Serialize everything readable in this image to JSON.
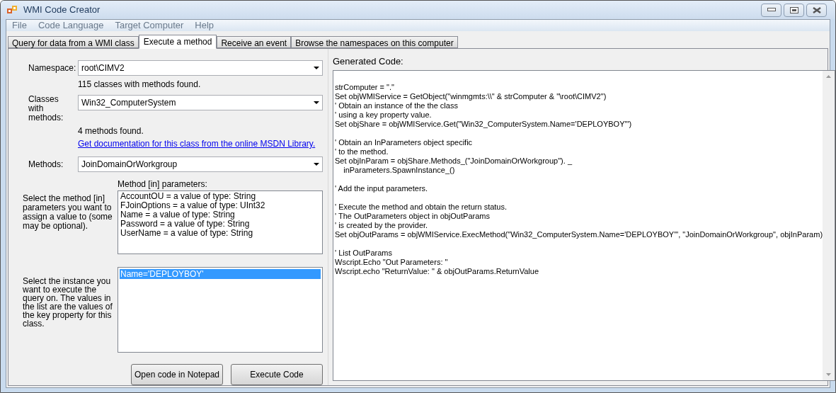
{
  "window": {
    "title": "WMI Code Creator"
  },
  "menu": [
    "File",
    "Code Language",
    "Target Computer",
    "Help"
  ],
  "tabs": [
    {
      "label": "Query for data from a WMI class",
      "selected": false
    },
    {
      "label": "Execute a method",
      "selected": true
    },
    {
      "label": "Receive an event",
      "selected": false
    },
    {
      "label": "Browse the namespaces on this computer",
      "selected": false
    }
  ],
  "namespace": {
    "label": "Namespace:",
    "value": "root\\CIMV2",
    "status": "115 classes with methods found."
  },
  "classes": {
    "label": "Classes with methods:",
    "value": "Win32_ComputerSystem",
    "status": "4 methods found.",
    "link": "Get documentation for this class from the online MSDN Library."
  },
  "methods": {
    "label": "Methods:",
    "value": "JoinDomainOrWorkgroup"
  },
  "parameters": {
    "hint": "Select the method [in] parameters you want to assign a value to (some may be optional).",
    "title": "Method [in] parameters:",
    "items": [
      "AccountOU =  a value of type: String",
      "FJoinOptions =  a value of type: UInt32",
      "Name =  a value of type: String",
      "Password =  a value of type: String",
      "UserName =  a value of type: String"
    ]
  },
  "instances": {
    "hint": "Select the instance you want to execute the query on. The values in the list are the values of the key property for this class.",
    "items": [
      {
        "label": "Name='DEPLOYBOY'",
        "selected": true
      }
    ]
  },
  "buttons": [
    "Open code in Notepad",
    "Execute Code"
  ],
  "code": {
    "title": "Generated Code:",
    "blocks": [
      [
        "strComputer = \".\"",
        "Set objWMIService = GetObject(\"winmgmts:\\\\\" & strComputer & \"\\root\\CIMV2\")",
        "' Obtain an instance of the the class",
        "' using a key property value.",
        "Set objShare = objWMIService.Get(\"Win32_ComputerSystem.Name='DEPLOYBOY'\")"
      ],
      [
        "' Obtain an InParameters object specific",
        "' to the method.",
        "Set objInParam = objShare.Methods_(\"JoinDomainOrWorkgroup\"). _",
        "    inParameters.SpawnInstance_()"
      ],
      [
        "' Add the input parameters."
      ],
      [
        "' Execute the method and obtain the return status.",
        "' The OutParameters object in objOutParams",
        "' is created by the provider.",
        "Set objOutParams = objWMIService.ExecMethod(\"Win32_ComputerSystem.Name='DEPLOYBOY'\", \"JoinDomainOrWorkgroup\", objInParam)"
      ],
      [
        "' List OutParams",
        "Wscript.Echo \"Out Parameters: \"",
        "Wscript.echo \"ReturnValue: \" & objOutParams.ReturnValue"
      ]
    ]
  }
}
